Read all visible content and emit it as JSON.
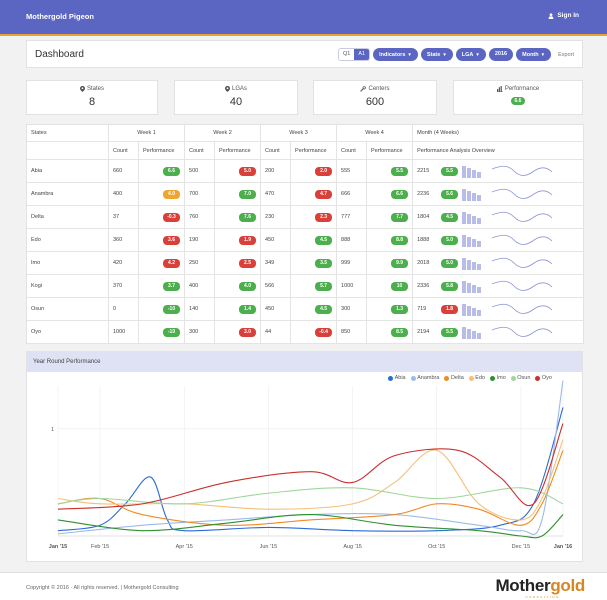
{
  "app": {
    "brand": "Mothergold Pigeon",
    "signin_label": "Sign In"
  },
  "header": {
    "title": "Dashboard",
    "segment": [
      "Q1",
      "A1"
    ],
    "segment_active": 1,
    "filters": [
      "Indicators",
      "State",
      "LGA",
      "2016",
      "Month"
    ],
    "export_label": "Export"
  },
  "stats": [
    {
      "label": "States",
      "icon": "map-marker-icon",
      "value": "8"
    },
    {
      "label": "LGAs",
      "icon": "map-marker-icon",
      "value": "40"
    },
    {
      "label": "Centers",
      "icon": "wrench-icon",
      "value": "600"
    },
    {
      "label": "Performance",
      "icon": "bar-chart-icon",
      "badge": "6.6"
    }
  ],
  "table": {
    "states_header": "States",
    "weeks": [
      "Week 1",
      "Week 2",
      "Week 3",
      "Week 4"
    ],
    "month_header": "Month (4 Weeks)",
    "count_label": "Count",
    "perf_label": "Performance",
    "overview_label": "Performance Analysis Overview",
    "rows": [
      {
        "state": "Abia",
        "weeks": [
          [
            "660",
            "6.6",
            "green"
          ],
          [
            "500",
            "5.0",
            "red"
          ],
          [
            "200",
            "2.0",
            "red"
          ],
          [
            "555",
            "5.5",
            "green"
          ]
        ],
        "month": [
          "2215",
          "5.5",
          "green"
        ]
      },
      {
        "state": "Anambra",
        "weeks": [
          [
            "400",
            "4.0",
            "orange"
          ],
          [
            "700",
            "7.0",
            "green"
          ],
          [
            "470",
            "4.7",
            "red"
          ],
          [
            "666",
            "6.6",
            "green"
          ]
        ],
        "month": [
          "2236",
          "5.6",
          "green"
        ]
      },
      {
        "state": "Delta",
        "weeks": [
          [
            "37",
            "-0.3",
            "red"
          ],
          [
            "760",
            "7.6",
            "green"
          ],
          [
            "230",
            "2.3",
            "red"
          ],
          [
            "777",
            "7.7",
            "green"
          ]
        ],
        "month": [
          "1804",
          "4.5",
          "green"
        ]
      },
      {
        "state": "Edo",
        "weeks": [
          [
            "360",
            "3.6",
            "red"
          ],
          [
            "190",
            "1.9",
            "red"
          ],
          [
            "450",
            "4.5",
            "green"
          ],
          [
            "888",
            "8.8",
            "green"
          ]
        ],
        "month": [
          "1888",
          "5.0",
          "green"
        ]
      },
      {
        "state": "Imo",
        "weeks": [
          [
            "420",
            "4.2",
            "red"
          ],
          [
            "250",
            "2.5",
            "red"
          ],
          [
            "349",
            "3.5",
            "green"
          ],
          [
            "999",
            "9.9",
            "green"
          ]
        ],
        "month": [
          "2018",
          "5.0",
          "green"
        ]
      },
      {
        "state": "Kogi",
        "weeks": [
          [
            "370",
            "3.7",
            "green"
          ],
          [
            "400",
            "4.0",
            "green"
          ],
          [
            "566",
            "5.7",
            "green"
          ],
          [
            "1000",
            "10",
            "green"
          ]
        ],
        "month": [
          "2336",
          "5.8",
          "green"
        ]
      },
      {
        "state": "Osun",
        "weeks": [
          [
            "0",
            "-10",
            "green"
          ],
          [
            "140",
            "1.4",
            "green"
          ],
          [
            "450",
            "4.5",
            "green"
          ],
          [
            "300",
            "1.3",
            "green"
          ]
        ],
        "month": [
          "719",
          "1.8",
          "red"
        ]
      },
      {
        "state": "Oyo",
        "weeks": [
          [
            "1000",
            "-10",
            "green"
          ],
          [
            "300",
            "3.0",
            "red"
          ],
          [
            "44",
            "-0.4",
            "red"
          ],
          [
            "850",
            "8.5",
            "green"
          ]
        ],
        "month": [
          "2194",
          "5.5",
          "green"
        ]
      }
    ]
  },
  "chart_panel": {
    "title": "Year Round Performance"
  },
  "colors": {
    "primary": "#5a66c2",
    "accent": "#e9a23b",
    "green": "#4cae4c",
    "red": "#d9403a",
    "orange": "#efa534",
    "minibar": "#b7bde8",
    "spark": "#8a93d6"
  },
  "chart_data": {
    "type": "line",
    "x_tick_labels": [
      "Jan '15",
      "Feb '15",
      "Apr '15",
      "Jun '15",
      "Aug '15",
      "Oct '15",
      "Dec '15",
      "Jan '16"
    ],
    "x_tick_month_index": [
      0,
      1,
      3,
      5,
      7,
      9,
      11,
      12
    ],
    "y_ticks": [
      1
    ],
    "ylim": [
      0,
      1.4
    ],
    "grid": true,
    "legend_position": "top-right",
    "series": [
      {
        "name": "Abia",
        "color": "#2b6bd6",
        "points": [
          [
            0,
            0.05
          ],
          [
            1,
            0.1
          ],
          [
            1.6,
            0.3
          ],
          [
            2.2,
            0.55
          ],
          [
            2.6,
            0.15
          ],
          [
            3,
            0.05
          ],
          [
            5,
            0.08
          ],
          [
            7,
            0.05
          ],
          [
            9,
            0.05
          ],
          [
            10.5,
            0.1
          ],
          [
            11.3,
            0.3
          ],
          [
            12,
            1.2
          ]
        ]
      },
      {
        "name": "Anambra",
        "color": "#9cbbe8",
        "points": [
          [
            0,
            0.02
          ],
          [
            2,
            0.1
          ],
          [
            4,
            0.15
          ],
          [
            6,
            0.2
          ],
          [
            8,
            0.2
          ],
          [
            10,
            0.1
          ],
          [
            11,
            0.05
          ],
          [
            11.5,
            0.15
          ],
          [
            12,
            1.45
          ]
        ]
      },
      {
        "name": "Delta",
        "color": "#f08a24",
        "points": [
          [
            0,
            0.3
          ],
          [
            1,
            0.35
          ],
          [
            2,
            0.2
          ],
          [
            4,
            0.1
          ],
          [
            6,
            0.15
          ],
          [
            8,
            0.2
          ],
          [
            9,
            0.3
          ],
          [
            10,
            0.25
          ],
          [
            11,
            0.1
          ],
          [
            11.5,
            0.3
          ],
          [
            12,
            0.8
          ]
        ]
      },
      {
        "name": "Edo",
        "color": "#f5c07a",
        "points": [
          [
            0,
            0.35
          ],
          [
            1,
            0.3
          ],
          [
            3,
            0.3
          ],
          [
            5,
            0.25
          ],
          [
            7,
            0.3
          ],
          [
            8,
            0.5
          ],
          [
            9,
            0.8
          ],
          [
            10,
            0.3
          ],
          [
            11,
            0.15
          ],
          [
            11.5,
            0.35
          ],
          [
            12,
            0.9
          ]
        ]
      },
      {
        "name": "Imo",
        "color": "#2f8f2f",
        "points": [
          [
            0,
            0.15
          ],
          [
            2,
            0.05
          ],
          [
            4,
            0.12
          ],
          [
            6,
            0.2
          ],
          [
            8,
            0.1
          ],
          [
            10,
            0.05
          ],
          [
            11,
            0.0
          ],
          [
            11.5,
            0.0
          ],
          [
            12,
            0.2
          ]
        ]
      },
      {
        "name": "Osun",
        "color": "#9fd79b",
        "points": [
          [
            0,
            0.3
          ],
          [
            1,
            0.35
          ],
          [
            3,
            0.3
          ],
          [
            5,
            0.4
          ],
          [
            7,
            0.45
          ],
          [
            9,
            0.35
          ],
          [
            11,
            0.45
          ],
          [
            12,
            0.3
          ]
        ]
      },
      {
        "name": "Oyo",
        "color": "#c9302c",
        "points": [
          [
            0,
            0.25
          ],
          [
            2,
            0.3
          ],
          [
            4,
            0.5
          ],
          [
            6,
            0.6
          ],
          [
            7,
            0.5
          ],
          [
            8,
            0.75
          ],
          [
            9.5,
            0.8
          ],
          [
            10.5,
            0.55
          ],
          [
            11.3,
            0.3
          ],
          [
            12,
            1.05
          ]
        ]
      }
    ]
  },
  "footer": {
    "copyright": "Copyright © 2016 · All rights reserved. | Mothergold Consulting",
    "logo_main": "Mother",
    "logo_gold": "gold",
    "logo_sub": "CONSULTING"
  }
}
